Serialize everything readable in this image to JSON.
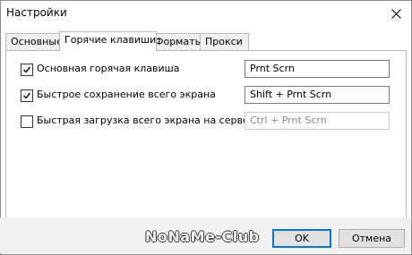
{
  "window": {
    "title": "Настройки"
  },
  "tabs": [
    {
      "label": "Основные",
      "active": false
    },
    {
      "label": "Горячие клавиши",
      "active": true
    },
    {
      "label": "Форматы",
      "active": false
    },
    {
      "label": "Прокси",
      "active": false
    }
  ],
  "hotkeys": [
    {
      "label": "Основная горячая клавиша",
      "checked": true,
      "value": "Prnt Scrn",
      "enabled": true
    },
    {
      "label": "Быстрое сохранение всего экрана",
      "checked": true,
      "value": "Shift + Prnt Scrn",
      "enabled": true
    },
    {
      "label": "Быстрая загрузка всего экрана на сервер",
      "checked": false,
      "value": "Ctrl + Prnt Scrn",
      "enabled": false
    }
  ],
  "footer": {
    "ok_label": "OK",
    "cancel_label": "Отмена",
    "watermark": "NoNaMe-Club"
  },
  "colors": {
    "accent": "#0078d7",
    "footer_bg": "#f0f0f0"
  }
}
